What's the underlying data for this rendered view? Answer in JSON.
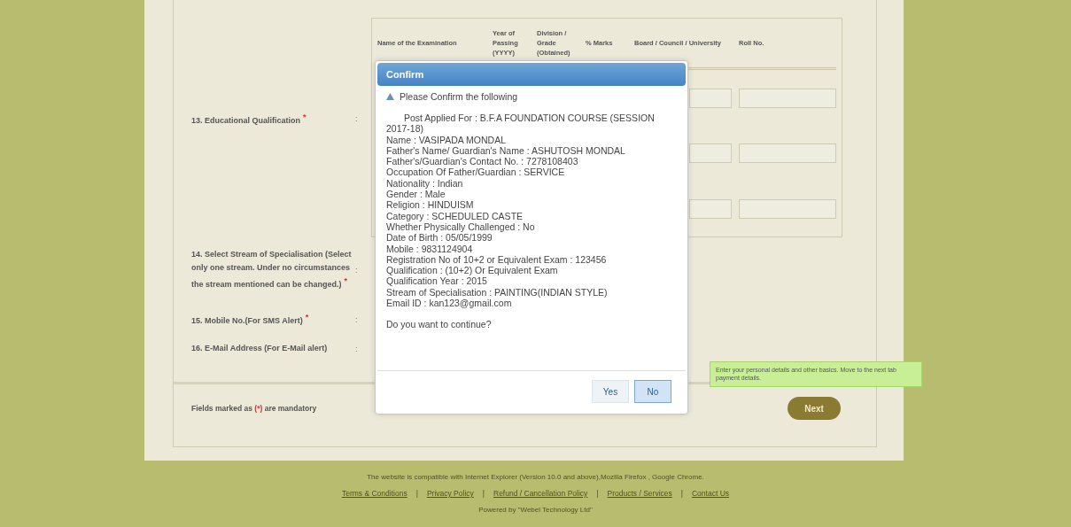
{
  "form": {
    "table": {
      "columns": [
        "Name of the Examination",
        "Year of Passing (YYYY)",
        "Division / Grade (Obtained)",
        "% Marks",
        "Board / Council / University",
        "Roll No."
      ]
    },
    "fields": [
      {
        "label": "13. Educational Qualification",
        "required_mark": "*",
        "colon": ":"
      },
      {
        "label": "14. Select Stream of Specialisation (Select only one stream. Under no circumstances the stream mentioned can be changed.)",
        "required_mark": "*",
        "colon": ":"
      },
      {
        "label": "15. Mobile No.(For SMS Alert)",
        "required_mark": "*",
        "colon": ":"
      },
      {
        "label": "16. E-Mail Address (For E-Mail alert)",
        "colon": ":"
      }
    ],
    "mandatory_note": {
      "before": "Fields marked as ",
      "mark": "(*)",
      "after": " are mandatory"
    },
    "next_button": "Next",
    "tooltip": "Enter your personal details and other basics. Move to the next tab payment details."
  },
  "dialog": {
    "title": "Confirm",
    "heading": "Please Confirm the following",
    "lines": [
      "Post Applied For : B.F.A FOUNDATION COURSE (SESSION 2017-18)",
      "Name : VASIPADA MONDAL",
      "Father's Name/ Guardian's Name : ASHUTOSH MONDAL",
      "Father's/Guardian's Contact No. : 7278108403",
      "Occupation Of Father/Guardian : SERVICE",
      "Nationality : Indian",
      "Gender : Male",
      "Religion : HINDUISM",
      "Category : SCHEDULED CASTE",
      "Whether Physically Challenged : No",
      "Date of Birth : 05/05/1999",
      "Mobile : 9831124904",
      "Registration No of 10+2 or Equivalent Exam : 123456",
      "Qualification : (10+2) Or Equivalent Exam",
      "Qualification Year : 2015",
      "Stream of Specialisation : PAINTING(INDIAN STYLE)",
      "Email ID : kan123@gmail.com"
    ],
    "question": "Do you want to continue?",
    "buttons": [
      {
        "label": "Yes",
        "selected": false
      },
      {
        "label": "No",
        "selected": true
      }
    ]
  },
  "footer": {
    "compat": "The website is compatible with Internet Explorer (Version 10.0 and above),Mozilla Firefox , Google Chrome.",
    "links": [
      "Terms & Conditions",
      "Privacy Policy",
      "Refund / Cancellation Policy",
      "Products / Services",
      "Contact Us"
    ],
    "separators": [
      "|",
      "|",
      "|",
      "|"
    ],
    "powered": "Powered by \"Webel Technology Ltd\""
  }
}
